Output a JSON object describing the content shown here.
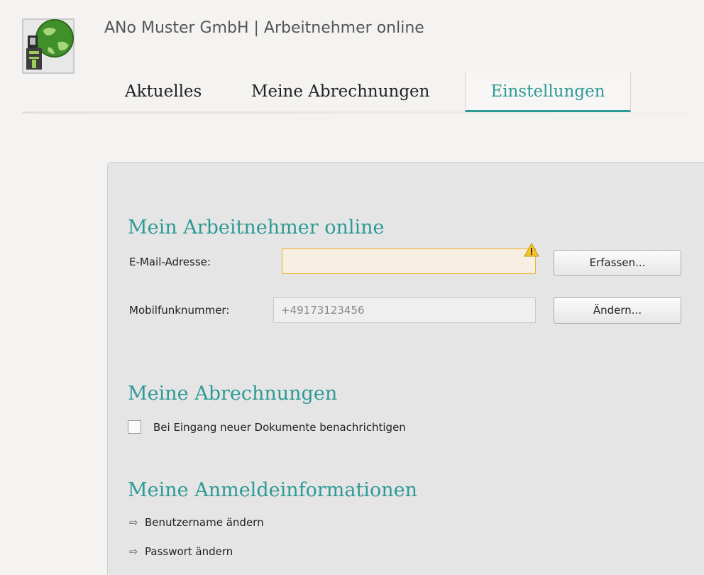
{
  "app": {
    "title": "ANo Muster GmbH | Arbeitnehmer online",
    "logo_icon": "globe-user-logo-icon"
  },
  "nav": {
    "tabs": [
      {
        "label": "Aktuelles",
        "active": false
      },
      {
        "label": "Meine Abrechnungen",
        "active": false
      },
      {
        "label": "Einstellungen",
        "active": true
      }
    ]
  },
  "settings": {
    "account": {
      "title": "Mein Arbeitnehmer online",
      "email_label": "E-Mail-Adresse:",
      "email_value": "",
      "email_warning_icon": "warning-icon",
      "email_button": "Erfassen...",
      "mobile_label": "Mobilfunknummer:",
      "mobile_value": "+49173123456",
      "mobile_button": "Ändern..."
    },
    "statements": {
      "title": "Meine Abrechnungen",
      "notify_label": "Bei Eingang neuer Dokumente benachrichtigen",
      "notify_checked": false
    },
    "login": {
      "title": "Meine Anmeldeinformationen",
      "links": [
        {
          "label": "Benutzername ändern",
          "icon": "arrow-right-icon"
        },
        {
          "label": "Passwort ändern",
          "icon": "arrow-right-icon"
        }
      ]
    }
  },
  "colors": {
    "accent": "#2e9a96",
    "warning_border": "#f0b22a",
    "panel_bg": "#e5e5e5",
    "page_bg": "#f4f3f1"
  }
}
